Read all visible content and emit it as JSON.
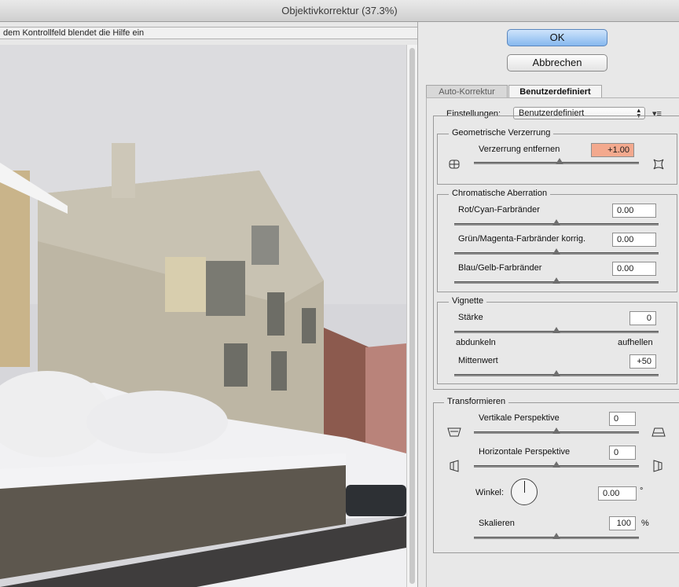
{
  "window": {
    "title": "Objektivkorrektur (37.3%)"
  },
  "hint_text": "dem Kontrollfeld blendet die Hilfe ein",
  "buttons": {
    "ok": "OK",
    "cancel": "Abbrechen"
  },
  "tabs": [
    {
      "label": "Auto-Korrektur",
      "active": false
    },
    {
      "label": "Benutzerdefiniert",
      "active": true
    }
  ],
  "settings": {
    "label": "Einstellungen:",
    "value": "Benutzerdefiniert"
  },
  "geometric": {
    "legend": "Geometrische Verzerrung",
    "label": "Verzerrung entfernen",
    "value": "+1.00",
    "slider": 0.52
  },
  "chromatic": {
    "legend": "Chromatische Aberration",
    "items": [
      {
        "label": "Rot/Cyan-Farbränder",
        "value": "0.00",
        "slider": 0.5
      },
      {
        "label": "Grün/Magenta-Farbränder korrig.",
        "value": "0.00",
        "slider": 0.5
      },
      {
        "label": "Blau/Gelb-Farbränder",
        "value": "0.00",
        "slider": 0.5
      }
    ]
  },
  "vignette": {
    "legend": "Vignette",
    "strength": {
      "label": "Stärke",
      "value": "0",
      "slider": 0.5
    },
    "darken_label": "abdunkeln",
    "lighten_label": "aufhellen",
    "midpoint": {
      "label": "Mittenwert",
      "value": "+50",
      "slider": 0.5
    }
  },
  "transform": {
    "legend": "Transformieren",
    "vertical": {
      "label": "Vertikale Perspektive",
      "value": "0",
      "slider": 0.5
    },
    "horizontal": {
      "label": "Horizontale Perspektive",
      "value": "0",
      "slider": 0.5
    },
    "angle": {
      "label": "Winkel:",
      "value": "0.00",
      "unit": "°"
    },
    "scale": {
      "label": "Skalieren",
      "value": "100",
      "unit": "%",
      "slider": 0.5
    }
  },
  "colors": {
    "accent": "#86b8ef",
    "highlight": "#f3a98e"
  }
}
